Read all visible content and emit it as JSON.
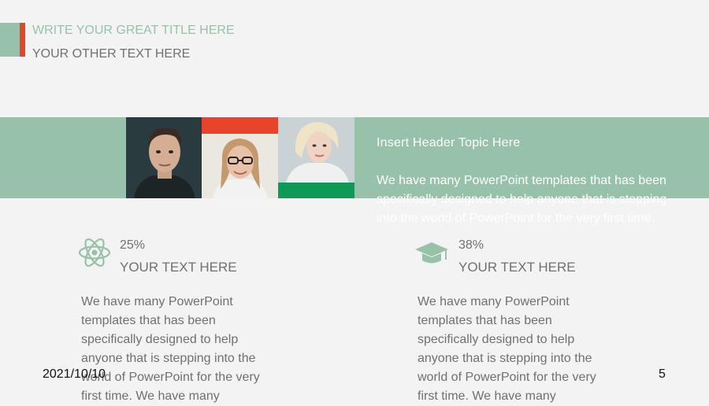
{
  "header": {
    "title": "WRITE YOUR GREAT TITLE HERE",
    "subtitle": "YOUR OTHER TEXT HERE"
  },
  "banner": {
    "topic": "Insert Header Topic Here",
    "description": "We have many PowerPoint templates that has been specifically designed to help anyone that is stepping into the world of PowerPoint for the very first time."
  },
  "stats": [
    {
      "icon": "atom-icon",
      "value": "25%",
      "label": "YOUR TEXT HERE",
      "body": "We have many PowerPoint templates that has been specifically designed to help anyone that is stepping into the world of PowerPoint for the very first time. We have many"
    },
    {
      "icon": "graduation-cap-icon",
      "value": "38%",
      "label": "YOUR TEXT HERE",
      "body": "We have many PowerPoint templates that has been specifically designed to help anyone that is stepping into the world of PowerPoint for the very first time. We have many"
    }
  ],
  "footer": {
    "date": "2021/10/10",
    "page_number": "5"
  },
  "colors": {
    "accent_green": "#97c1a9",
    "accent_red": "#e8442a",
    "deep_green": "#0e9a56",
    "text_gray": "#707070"
  }
}
